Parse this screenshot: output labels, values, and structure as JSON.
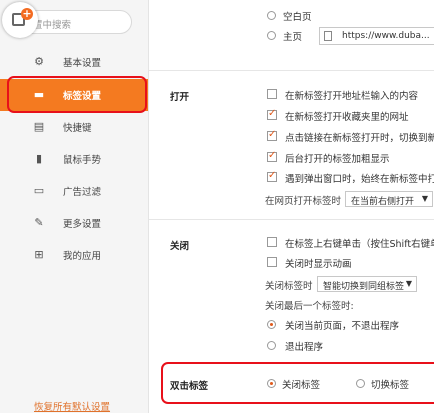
{
  "search": {
    "placeholder": "置中搜索"
  },
  "sidebar": {
    "items": [
      {
        "label": "基本设置",
        "icon": "gear-icon"
      },
      {
        "label": "标签设置",
        "icon": "tab-icon",
        "active": true
      },
      {
        "label": "快捷键",
        "icon": "keyboard-icon"
      },
      {
        "label": "鼠标手势",
        "icon": "mouse-icon"
      },
      {
        "label": "广告过滤",
        "icon": "filter-icon"
      },
      {
        "label": "更多设置",
        "icon": "wrench-icon"
      },
      {
        "label": "我的应用",
        "icon": "apps-icon"
      }
    ],
    "restore_label": "恢复所有默认设置"
  },
  "startup": {
    "blank_page": "空白页",
    "home_page": "主页",
    "home_url": "https://www.duba..."
  },
  "open_section": {
    "title": "打开",
    "options": [
      {
        "label": "在新标签打开地址栏输入的内容",
        "checked": false
      },
      {
        "label": "在新标签打开收藏夹里的网址",
        "checked": true
      },
      {
        "label": "点击链接在新标签打开时，切换到新标",
        "checked": true
      },
      {
        "label": "后台打开的标签加粗显示",
        "checked": true
      },
      {
        "label": "遇到弹出窗口时，始终在新标签中打开",
        "checked": true
      }
    ],
    "open_position_label": "在网页打开标签时",
    "open_position_value": "在当前右侧打开"
  },
  "close_section": {
    "title": "关闭",
    "options": [
      {
        "label": "在标签上右键单击（按住Shift右键单击",
        "checked": false
      },
      {
        "label": "关闭时显示动画",
        "checked": false
      }
    ],
    "close_tab_label": "关闭标签时",
    "close_tab_value": "智能切换到同组标签",
    "last_tab_label": "关闭最后一个标签时:",
    "last_tab_options": [
      {
        "label": "关闭当前页面，不退出程序",
        "selected": true
      },
      {
        "label": "退出程序",
        "selected": false
      }
    ]
  },
  "double_click": {
    "title": "双击标签",
    "options": [
      {
        "label": "关闭标签",
        "selected": true
      },
      {
        "label": "切换标签",
        "selected": false
      }
    ]
  },
  "colors": {
    "accent": "#f47a20",
    "highlight": "#e8101a"
  }
}
